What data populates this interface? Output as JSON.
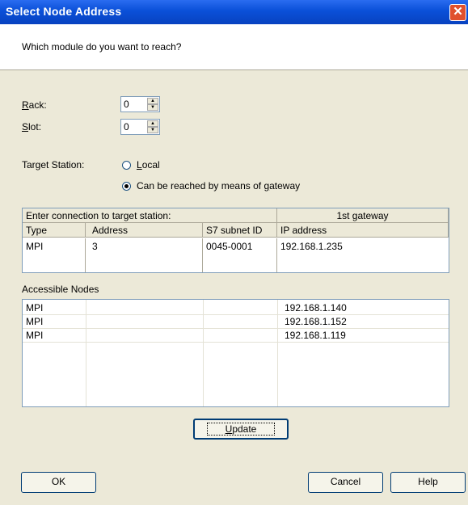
{
  "window": {
    "title": "Select Node Address",
    "close_glyph": "✕"
  },
  "header": {
    "question": "Which module do you want to reach?"
  },
  "form": {
    "rack_label_u": "R",
    "rack_label_rest": "ack:",
    "rack_value": "0",
    "slot_label_u": "S",
    "slot_label_rest": "lot:",
    "slot_value": "0",
    "target_station_label": "Target Station:",
    "local_label_u": "L",
    "local_label_rest": "ocal",
    "gateway_label_pre": "Can be reached by means of ",
    "gateway_label_u": "g",
    "gateway_label_rest": "ateway",
    "selected_option": "gateway"
  },
  "connection_table": {
    "group_left": "Enter connection to target station:",
    "group_right": "1st gateway",
    "columns": [
      "Type",
      "Address",
      "S7 subnet ID",
      "IP address"
    ],
    "rows": [
      {
        "type": "MPI",
        "address": "3",
        "subnet": "0045-0001",
        "ip": "192.168.1.235"
      }
    ]
  },
  "accessible": {
    "label": "Accessible Nodes",
    "rows": [
      {
        "type": "MPI",
        "ip": "192.168.1.140"
      },
      {
        "type": "MPI",
        "ip": "192.168.1.152"
      },
      {
        "type": "MPI",
        "ip": "192.168.1.119"
      }
    ]
  },
  "buttons": {
    "update_u": "U",
    "update_rest": "pdate",
    "ok": "OK",
    "cancel": "Cancel",
    "help": "Help"
  }
}
